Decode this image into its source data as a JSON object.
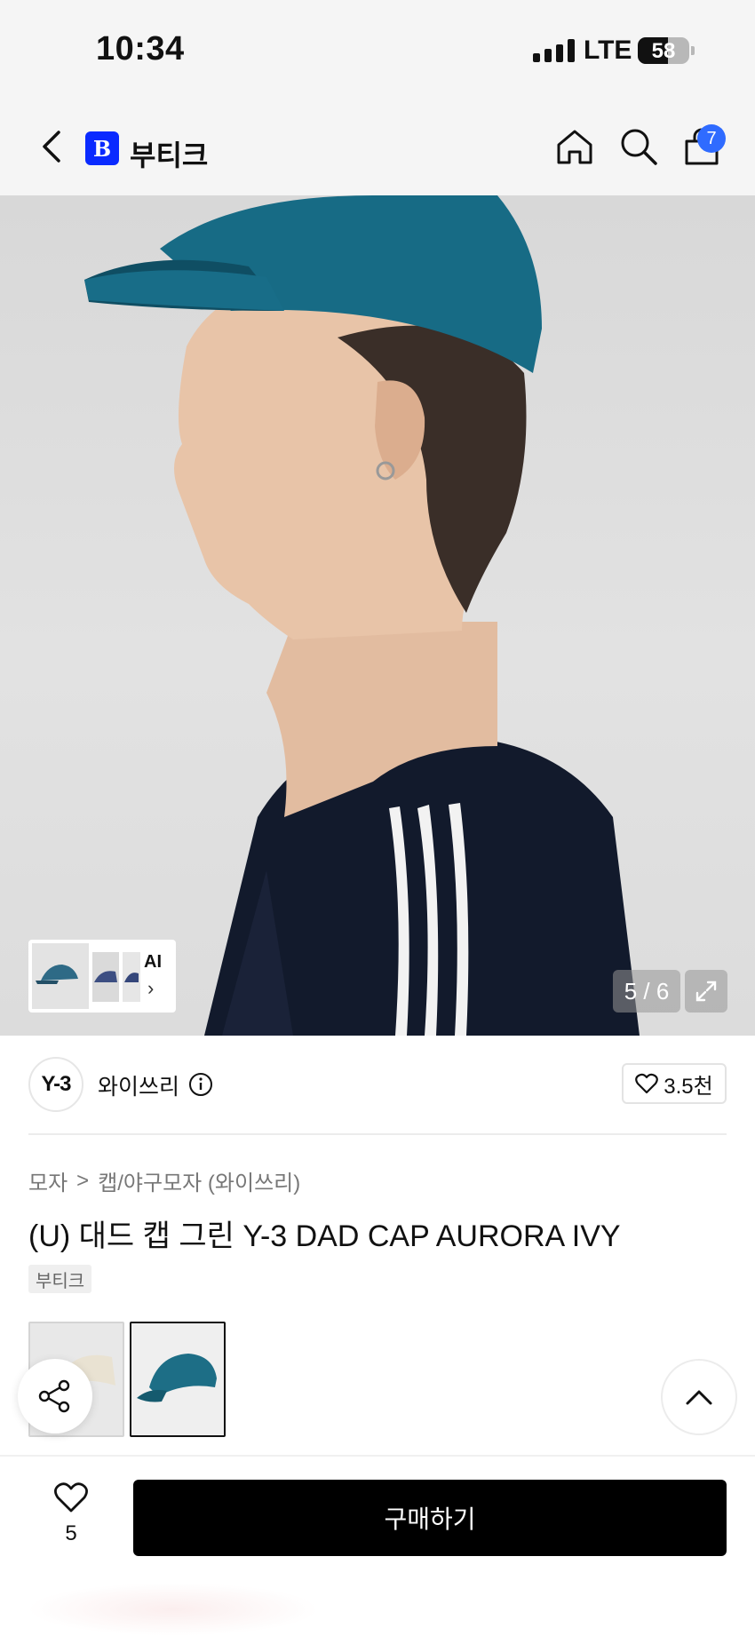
{
  "status_bar": {
    "time": "10:34",
    "network": "LTE",
    "battery": "58",
    "battery_level": 0.58
  },
  "header": {
    "brand_badge": "B",
    "brand_name": "부티크",
    "cart_count": "7"
  },
  "hero": {
    "ai_label": "AI",
    "page_counter": "5 / 6",
    "colors": {
      "cap": "#176b85",
      "cap_shadow": "#0f4e63",
      "skin": "#e8c4a8",
      "shirt": "#121a2c",
      "stripe": "#f2f2f2"
    }
  },
  "brand": {
    "logo": "Y-3",
    "name": "와이쓰리",
    "likes": "3.5천"
  },
  "breadcrumb": {
    "level1": "모자",
    "separator": ">",
    "level2": "캡/야구모자 (와이쓰리)"
  },
  "product": {
    "title": "(U) 대드 캡 그린 Y-3 DAD CAP AURORA IVY",
    "tag": "부티크"
  },
  "bottom_bar": {
    "wish_count": "5",
    "buy_label": "구매하기"
  },
  "icons": [
    "chevron-left-icon",
    "home-icon",
    "search-icon",
    "shopping-bag-icon",
    "expand-icon",
    "info-icon",
    "heart-icon",
    "share-icon",
    "chevron-up-icon"
  ]
}
